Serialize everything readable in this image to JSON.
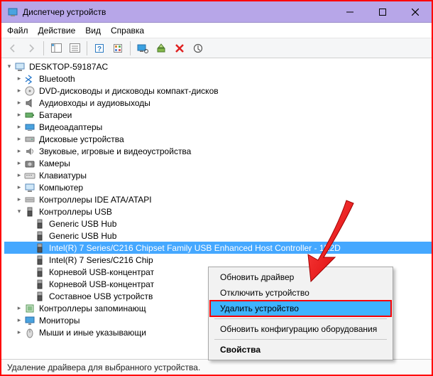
{
  "window": {
    "title": "Диспетчер устройств"
  },
  "menu": {
    "file": "Файл",
    "action": "Действие",
    "view": "Вид",
    "help": "Справка"
  },
  "tree": {
    "root": "DESKTOP-59187AC",
    "cat_bluetooth": "Bluetooth",
    "cat_dvd": "DVD-дисководы и дисководы компакт-дисков",
    "cat_audio": "Аудиовходы и аудиовыходы",
    "cat_battery": "Батареи",
    "cat_video": "Видеоадаптеры",
    "cat_disk": "Дисковые устройства",
    "cat_sound": "Звуковые, игровые и видеоустройства",
    "cat_camera": "Камеры",
    "cat_keyboard": "Клавиатуры",
    "cat_computer": "Компьютер",
    "cat_ide": "Контроллеры IDE ATA/ATAPI",
    "cat_usb": "Контроллеры USB",
    "usb_generic1": "Generic USB Hub",
    "usb_generic2": "Generic USB Hub",
    "usb_intel1": "Intel(R) 7 Series/C216 Chipset Family USB Enhanced Host Controller - 1E2D",
    "usb_intel2": "Intel(R) 7 Series/C216 Chip",
    "usb_root1": "Корневой USB-концентрат",
    "usb_root2": "Корневой USB-концентрат",
    "usb_composite": "Составное USB устройств",
    "cat_storage": "Контроллеры запоминающ",
    "cat_monitor": "Мониторы",
    "cat_mouse": "Мыши и иные указывающи"
  },
  "context_menu": {
    "update": "Обновить драйвер",
    "disable": "Отключить устройство",
    "delete": "Удалить устройство",
    "refresh": "Обновить конфигурацию оборудования",
    "properties": "Свойства"
  },
  "status": "Удаление драйвера для выбранного устройства."
}
